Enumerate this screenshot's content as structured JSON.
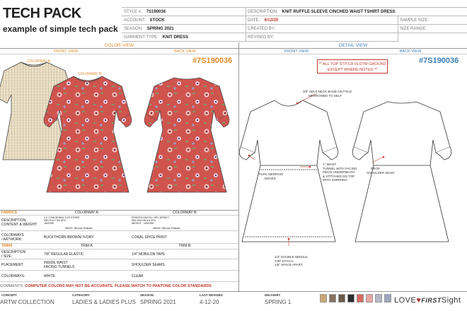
{
  "header": {
    "title": "TECH PACK",
    "subtitle": "example of simple tech pack",
    "style_label": "STYLE #:",
    "style_value": "7S190036",
    "account_label": "ACCOUNT:",
    "account_value": "STOCK",
    "season_label": "SEASON:",
    "season_value": "SPRING 2021",
    "garment_label": "GARMENT TYPE:",
    "garment_value": "KNIT DRESS",
    "description_label": "DESCRIPTION:",
    "description_value": "KNIT RUFFLE SLEEVE CINCHED WAIST TSHIRT DRESS",
    "date_label": "DATE:",
    "date_value": "4/12/20",
    "created_label": "CREATED BY:",
    "revised_label": "REVISED BY:",
    "sample_size_label": "SAMPLE SIZE:",
    "size_range_label": "SIZE RANGE:"
  },
  "color_view": {
    "title": "COLOR VIEW",
    "front": "FRONT VIEW",
    "back": "BACK VIEW",
    "style_tag": "#7S190036",
    "colorway_a": "COLORWAY A:",
    "colorway_b": "COLORWAY B:"
  },
  "detail_view": {
    "title": "DETAIL VIEW",
    "front": "FRONT VIEW",
    "back": "BACK VIEW",
    "style_tag": "#7S190036",
    "note_line1": "** ALL TOP STITCH IS DTM GROUND",
    "note_line2": "EXCEPT WHERE NOTED **",
    "callouts": {
      "neck": "3/8\" SELF NECK BAND ON FOLD",
      "neck2": "MERROWED TO SELF",
      "merrow": "PURL MERROW",
      "merrow2": "EDGES",
      "waist1": "1\" WAIST",
      "waist2": "TUNNEL WITH FACING",
      "waist3": "PIECE UNDERNEATH",
      "waist4": "& STITCHED ON TOP",
      "waist5": "WITH SHIRRING",
      "drop1": "DROP",
      "drop2": "SHOULDER SEAM",
      "hem1": "1/2\" DOUBLE NEEDLE",
      "hem2": "TOP STITCH",
      "hem3": "1/8\" SPACE APART"
    }
  },
  "table": {
    "fabrics": "FABRICS",
    "colorway_a": "COLORWAY A:",
    "colorway_b": "COLORWAY B:",
    "desc_label1": "DESCRIPTION,",
    "desc_label2": "CONTENT & WEIGHT:",
    "fabric_a1": "4 X 2 RIB SKINNY DYE STRIPE",
    "fabric_a2": "95% POLY 5% SPX",
    "fabric_a3": "180GSM",
    "fabric_b1": "PRINTED RAYON / SPX JERSEY",
    "fabric_b2": "95% RAYON 5% SPX",
    "fabric_b3": "WEIGHT - 180GSM",
    "wash_label": "WASH:",
    "wash_a": "Silicone Softener",
    "wash_b": "Silicone Softener",
    "colorways_label1": "COLORWAYS",
    "colorways_label2": "/ ARTWORK:",
    "colorway_a_val": "BUCKTHORN BROWN/ IVORY",
    "colorway_b_val": "CORAL SPICE PRINT",
    "trims": "TRIMS",
    "trim_a": "TRIM A:",
    "trim_b": "TRIM B:",
    "trim_desc1": "DESCRIPTION",
    "trim_desc2": "/ SIZE:",
    "trim_a_desc": "7/8\" REGULAR ELASTIC",
    "trim_b_desc": "1/4\" MOBILON TAPE",
    "placement_label": "PLACEMENT:",
    "placement_a1": "INSIDE WAIST",
    "placement_a2": "FACING TUNNELS",
    "placement_b": "SHOULDER SEAMS",
    "colorways2_label": "COLORWAYS:",
    "trim_a_color": "WHITE",
    "trim_b_color": "CLEAR"
  },
  "comments": {
    "label": "COMMENTS:",
    "text": "COMPUTER COLORS MAY NOT BE ACCURATE. PLEASE MATCH TO PANTONE COLOR STANDARDS"
  },
  "footer": {
    "concept_label": "CONCEPT",
    "concept_value": "ARTW COLLECTION",
    "category_label": "CATEGORY",
    "category_value": "LADIES & LADIES PLUS",
    "season_label": "SEASON",
    "season_value": "SPRING 2021",
    "revised_label": "LAST REVISED",
    "revised_value": "4-12-20",
    "delivery_label": "DELIVERY",
    "delivery_value": "SPRING 1",
    "logo_left": "LOVE",
    "logo_mid": "FIRST",
    "logo_right": "Sight"
  },
  "swatches": [
    {
      "color": "#c9a77a"
    },
    {
      "color": "#8a7360"
    },
    {
      "color": "#6b5a4a"
    },
    {
      "color": "#2c2c2c"
    },
    {
      "color": "#d96a63"
    },
    {
      "color": "#e8a6a0"
    },
    {
      "color": "#b7b7c9"
    },
    {
      "color": "#9fa6c0"
    }
  ],
  "colors": {
    "orange": "#e08a2a",
    "blue": "#3a7fb8",
    "red": "#c0392b",
    "coral": "#d0544e",
    "beige": "#e8dcc4"
  }
}
